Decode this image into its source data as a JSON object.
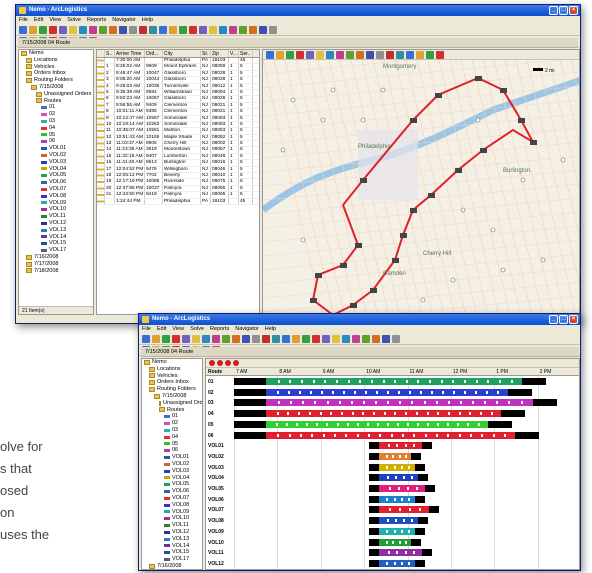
{
  "back": {
    "title": "Nemo - ArcLogistics",
    "menu": [
      "File",
      "Edit",
      "View",
      "Solve",
      "Reports",
      "Navigator",
      "Help"
    ],
    "subbar": "7/15/2008 04 Route",
    "tree": [
      {
        "t": "Nemo",
        "c": "#2a5fc0",
        "i": 0
      },
      {
        "t": "Locations",
        "c": "#d04040",
        "i": 1
      },
      {
        "t": "Vehicles",
        "c": "#c03030",
        "i": 1
      },
      {
        "t": "Orders Inbox",
        "c": "#3050b0",
        "i": 1
      },
      {
        "t": "Routing Folders",
        "c": "#e8c15a",
        "i": 1
      },
      {
        "t": "7/15/2008",
        "c": "#e8c15a",
        "i": 2
      },
      {
        "t": "Unassigned Orders",
        "c": "#888",
        "i": 3
      },
      {
        "t": "Routes",
        "c": "#3aa03a",
        "i": 3
      },
      {
        "t": "01",
        "c": "#4070d0",
        "i": 4
      },
      {
        "t": "02",
        "c": "#d050c0",
        "i": 4
      },
      {
        "t": "03",
        "c": "#30b0b0",
        "i": 4
      },
      {
        "t": "04",
        "c": "#e03030",
        "i": 4
      },
      {
        "t": "05",
        "c": "#30c030",
        "i": 4
      },
      {
        "t": "06",
        "c": "#b040b0",
        "i": 4
      },
      {
        "t": "VOL01",
        "c": "#2060a0",
        "i": 4
      },
      {
        "t": "VOL02",
        "c": "#d06030",
        "i": 4
      },
      {
        "t": "VOL03",
        "c": "#2040c0",
        "i": 4
      },
      {
        "t": "VOL04",
        "c": "#d0a000",
        "i": 4
      },
      {
        "t": "VOL05",
        "c": "#20a060",
        "i": 4
      },
      {
        "t": "VOL06",
        "c": "#3060b0",
        "i": 4
      },
      {
        "t": "VOL07",
        "c": "#e03030",
        "i": 4
      },
      {
        "t": "VOL08",
        "c": "#3030d0",
        "i": 4
      },
      {
        "t": "VOL09",
        "c": "#20b0b0",
        "i": 4
      },
      {
        "t": "VOL10",
        "c": "#a03090",
        "i": 4
      },
      {
        "t": "VOL11",
        "c": "#308030",
        "i": 4
      },
      {
        "t": "VOL12",
        "c": "#303090",
        "i": 4
      },
      {
        "t": "VOL13",
        "c": "#2080c0",
        "i": 4
      },
      {
        "t": "VOL14",
        "c": "#703090",
        "i": 4
      },
      {
        "t": "VOL15",
        "c": "#2050a0",
        "i": 4
      },
      {
        "t": "VOL17",
        "c": "#506070",
        "i": 4
      },
      {
        "t": "7/16/2008",
        "c": "#e8c15a",
        "i": 1
      },
      {
        "t": "7/17/2008",
        "c": "#e8c15a",
        "i": 1
      },
      {
        "t": "7/18/2008",
        "c": "#e8c15a",
        "i": 1
      }
    ],
    "status": "21 Item(s)",
    "grid": {
      "headers": [
        "",
        "S..",
        "Arrive Time",
        "Ord...",
        "City",
        "St.",
        "Zip",
        "V...",
        "Ser.."
      ],
      "rows": [
        [
          "",
          "",
          "7:30:00 AM",
          "",
          "Philadelphia",
          "PA",
          "19103",
          "",
          "45"
        ],
        [
          "",
          "1",
          "8:25:02 AM",
          "9609",
          "Mount Ephraim",
          "NJ",
          "08059",
          "1",
          "5"
        ],
        [
          "",
          "2",
          "8:46:47 AM",
          "10047",
          "Glassboro",
          "NJ",
          "08028",
          "1",
          "5"
        ],
        [
          "",
          "3",
          "9:05:20 AM",
          "10044",
          "Glassboro",
          "NJ",
          "08028",
          "1",
          "5"
        ],
        [
          "",
          "4",
          "9:26:03 AM",
          "10036",
          "Turnersville",
          "NJ",
          "08012",
          "1",
          "5"
        ],
        [
          "",
          "5",
          "9:35:38 AM",
          "9584",
          "Williamstown",
          "NJ",
          "08094",
          "1",
          "5"
        ],
        [
          "",
          "6",
          "9:52:23 AM",
          "10067",
          "Glassboro",
          "NJ",
          "08028",
          "1",
          "5"
        ],
        [
          "",
          "7",
          "9:56:55 AM",
          "9409",
          "Clementon",
          "NJ",
          "08021",
          "1",
          "5"
        ],
        [
          "",
          "8",
          "10:01:11 AM",
          "9385",
          "Clementon",
          "NJ",
          "08021",
          "1",
          "5"
        ],
        [
          "",
          "9",
          "10:12:47 AM",
          "10557",
          "Somerdale",
          "NJ",
          "08083",
          "1",
          "5"
        ],
        [
          "",
          "10",
          "10:19:14 AM",
          "10263",
          "Somerdale",
          "NJ",
          "08083",
          "1",
          "5"
        ],
        [
          "",
          "11",
          "10:36:07 AM",
          "10581",
          "Marlton",
          "NJ",
          "08053",
          "1",
          "5"
        ],
        [
          "",
          "12",
          "10:51:43 AM",
          "10165",
          "Maple Shade",
          "NJ",
          "08052",
          "1",
          "5"
        ],
        [
          "",
          "13",
          "11:03:37 AM",
          "9605",
          "Cherry Hill",
          "NJ",
          "08002",
          "1",
          "5"
        ],
        [
          "",
          "14",
          "11:23:35 AM",
          "3519",
          "Moorestown",
          "NJ",
          "08057",
          "1",
          "5"
        ],
        [
          "",
          "15",
          "11:32:19 AM",
          "9407",
          "Lumberton",
          "NJ",
          "08048",
          "1",
          "5"
        ],
        [
          "",
          "16",
          "11:41:40 AM",
          "9613",
          "Burlington",
          "NJ",
          "08016",
          "1",
          "5"
        ],
        [
          "",
          "17",
          "12:04:52 PM",
          "9476",
          "Willingboro",
          "NJ",
          "08046",
          "1",
          "5"
        ],
        [
          "",
          "18",
          "12:05:12 PM",
          "7702",
          "Beverly",
          "NJ",
          "08010",
          "1",
          "5"
        ],
        [
          "",
          "19",
          "12:17:19 PM",
          "10085",
          "Riverside",
          "NJ",
          "08075",
          "1",
          "5"
        ],
        [
          "",
          "20",
          "12:37:56 PM",
          "10037",
          "Palmyra",
          "NJ",
          "08065",
          "1",
          "5"
        ],
        [
          "",
          "21",
          "12:43:50 PM",
          "9419",
          "Palmyra",
          "NJ",
          "08065",
          "1",
          "5"
        ],
        [
          "",
          "",
          "1:24:44 PM",
          "",
          "Philadelphia",
          "PA",
          "19103",
          "",
          "45"
        ]
      ]
    },
    "map": {
      "scale": "2 mi",
      "places": [
        "Montgomery",
        "Philadelphia",
        "Burlington",
        "Camden",
        "Cherry Hill"
      ]
    }
  },
  "front": {
    "title": "Nemo - ArcLogistics",
    "menu": [
      "File",
      "Edit",
      "View",
      "Solve",
      "Reports",
      "Navigator",
      "Help"
    ],
    "subbar": "7/15/2008 04 Route",
    "tree": [
      {
        "t": "Nemo",
        "c": "#2a5fc0",
        "i": 0
      },
      {
        "t": "Locations",
        "c": "#d04040",
        "i": 1
      },
      {
        "t": "Vehicles",
        "c": "#c03030",
        "i": 1
      },
      {
        "t": "Orders Inbox",
        "c": "#3050b0",
        "i": 1
      },
      {
        "t": "Routing Folders",
        "c": "#e8c15a",
        "i": 1
      },
      {
        "t": "7/15/2008",
        "c": "#e8c15a",
        "i": 2
      },
      {
        "t": "Unassigned Orders",
        "c": "#888",
        "i": 3
      },
      {
        "t": "Routes",
        "c": "#3aa03a",
        "i": 3
      },
      {
        "t": "01",
        "c": "#4070d0",
        "i": 4
      },
      {
        "t": "02",
        "c": "#d050c0",
        "i": 4
      },
      {
        "t": "03",
        "c": "#30b0b0",
        "i": 4
      },
      {
        "t": "04",
        "c": "#e03030",
        "i": 4
      },
      {
        "t": "05",
        "c": "#30c030",
        "i": 4
      },
      {
        "t": "06",
        "c": "#b040b0",
        "i": 4
      },
      {
        "t": "VOL01",
        "c": "#2060a0",
        "i": 4
      },
      {
        "t": "VOL02",
        "c": "#d06030",
        "i": 4
      },
      {
        "t": "VOL03",
        "c": "#2040c0",
        "i": 4
      },
      {
        "t": "VOL04",
        "c": "#d0a000",
        "i": 4
      },
      {
        "t": "VOL05",
        "c": "#20a060",
        "i": 4
      },
      {
        "t": "VOL06",
        "c": "#3060b0",
        "i": 4
      },
      {
        "t": "VOL07",
        "c": "#e03030",
        "i": 4
      },
      {
        "t": "VOL08",
        "c": "#3030d0",
        "i": 4
      },
      {
        "t": "VOL09",
        "c": "#20b0b0",
        "i": 4
      },
      {
        "t": "VOL10",
        "c": "#a03090",
        "i": 4
      },
      {
        "t": "VOL11",
        "c": "#308030",
        "i": 4
      },
      {
        "t": "VOL12",
        "c": "#303090",
        "i": 4
      },
      {
        "t": "VOL13",
        "c": "#2080c0",
        "i": 4
      },
      {
        "t": "VOL14",
        "c": "#703090",
        "i": 4
      },
      {
        "t": "VOL15",
        "c": "#2050a0",
        "i": 4
      },
      {
        "t": "VOL17",
        "c": "#506070",
        "i": 4
      },
      {
        "t": "7/16/2008",
        "c": "#e8c15a",
        "i": 1
      },
      {
        "t": "7/17/2008",
        "c": "#e8c15a",
        "i": 1
      }
    ],
    "gantt": {
      "header": "Route",
      "times": [
        "7 AM",
        "8 AM",
        "9 AM",
        "10 AM",
        "11 AM",
        "12 PM",
        "1 PM",
        "2 PM"
      ],
      "rows": [
        {
          "n": "01",
          "c": "#20a060",
          "s": 0.0,
          "e": 0.9
        },
        {
          "n": "02",
          "c": "#2a3fd0",
          "s": 0.0,
          "e": 0.86
        },
        {
          "n": "03",
          "c": "#c030c0",
          "s": 0.0,
          "e": 0.93
        },
        {
          "n": "04",
          "c": "#e02030",
          "s": 0.0,
          "e": 0.84
        },
        {
          "n": "05",
          "c": "#30d030",
          "s": 0.0,
          "e": 0.8
        },
        {
          "n": "06",
          "c": "#e02030",
          "s": 0.0,
          "e": 0.88
        },
        {
          "n": "VOL01",
          "c": "#e02030",
          "s": 0.39,
          "e": 0.57
        },
        {
          "n": "VOL02",
          "c": "#e08030",
          "s": 0.39,
          "e": 0.54
        },
        {
          "n": "VOL03",
          "c": "#d0b000",
          "s": 0.39,
          "e": 0.55
        },
        {
          "n": "VOL04",
          "c": "#2040c0",
          "s": 0.39,
          "e": 0.56
        },
        {
          "n": "VOL05",
          "c": "#e02080",
          "s": 0.39,
          "e": 0.58
        },
        {
          "n": "VOL06",
          "c": "#2080d0",
          "s": 0.39,
          "e": 0.55
        },
        {
          "n": "VOL07",
          "c": "#e02030",
          "s": 0.39,
          "e": 0.59
        },
        {
          "n": "VOL08",
          "c": "#2050c0",
          "s": 0.39,
          "e": 0.56
        },
        {
          "n": "VOL09",
          "c": "#20b0b0",
          "s": 0.39,
          "e": 0.55
        },
        {
          "n": "VOL10",
          "c": "#20a030",
          "s": 0.39,
          "e": 0.54
        },
        {
          "n": "VOL11",
          "c": "#9030a0",
          "s": 0.39,
          "e": 0.57
        },
        {
          "n": "VOL12",
          "c": "#2060c0",
          "s": 0.39,
          "e": 0.55
        }
      ]
    }
  },
  "caption": [
    "olve for",
    "s that",
    "osed",
    "on",
    "uses the"
  ]
}
